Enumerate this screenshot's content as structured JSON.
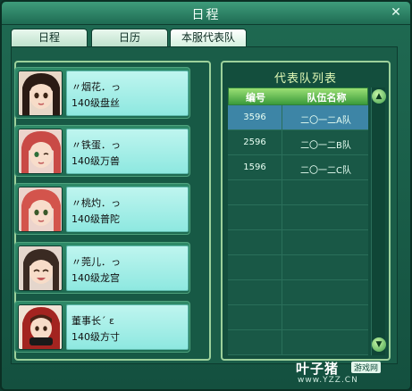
{
  "window": {
    "title": "日程"
  },
  "tabs": [
    {
      "label": "日程",
      "active": false
    },
    {
      "label": "日历",
      "active": false
    },
    {
      "label": "本服代表队",
      "active": true
    }
  ],
  "members": [
    {
      "name": "〃烟花．っ",
      "level": "140级盘丝",
      "avatar": "black-haired-girl"
    },
    {
      "name": "〃铁蛋．っ",
      "level": "140级万兽",
      "avatar": "red-haired-girl-wink"
    },
    {
      "name": "〃桃灼．っ",
      "level": "140级普陀",
      "avatar": "red-haired-girl"
    },
    {
      "name": "〃莞儿．っ",
      "level": "140级龙宫",
      "avatar": "dark-haired-girl-smile"
    },
    {
      "name": "董事长ˊ ε",
      "level": "140级方寸",
      "avatar": "red-hooded-character"
    }
  ],
  "team_list": {
    "title": "代表队列表",
    "columns": [
      "编号",
      "队伍名称"
    ],
    "rows": [
      {
        "id": "3596",
        "name": "二〇一二A队",
        "selected": true
      },
      {
        "id": "2596",
        "name": "二〇一二B队",
        "selected": false
      },
      {
        "id": "1596",
        "name": "二〇一二C队",
        "selected": false
      }
    ]
  },
  "watermark": {
    "main": "叶子猪",
    "box": "游戏网",
    "url": "www.YZZ.CN"
  },
  "colors": {
    "accent": "#9be074",
    "selected_row": "#3d85a6",
    "panel_border": "#9dd19b"
  }
}
